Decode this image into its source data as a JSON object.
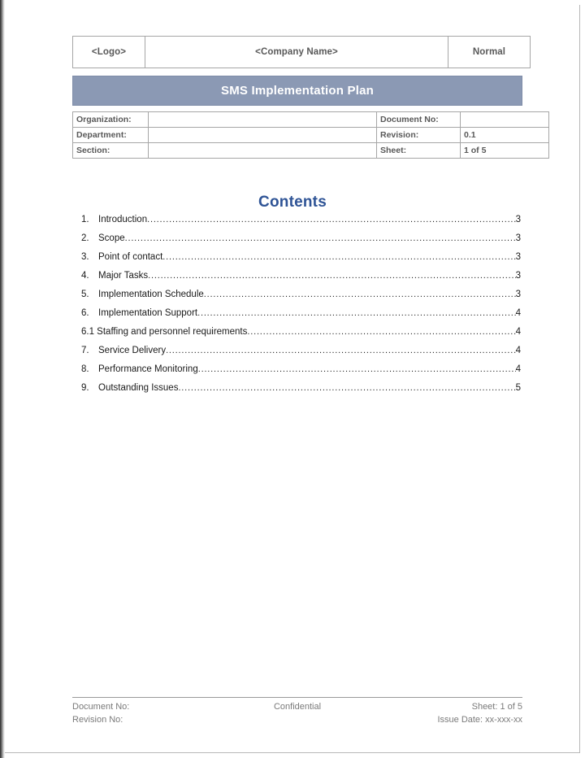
{
  "document": {
    "header_row": {
      "logo": "<Logo>",
      "company_name": "<Company Name>",
      "classification": "Normal"
    },
    "title_band": {
      "title": "SMS Implementation Plan",
      "background_color": "#8b99b4",
      "text_color": "#ffffff"
    },
    "meta_table": {
      "rows": [
        {
          "label": "Organization:",
          "value": "",
          "right_label": "Document No:",
          "right_value": ""
        },
        {
          "label": "Department:",
          "value": "",
          "right_label": "Revision:",
          "right_value": "0.1"
        },
        {
          "label": "Section:",
          "value": "",
          "right_label": "Sheet:",
          "right_value": "1 of 5"
        }
      ]
    },
    "contents": {
      "heading": "Contents",
      "heading_color": "#2f5496",
      "entries": [
        {
          "number": "1.",
          "label": "Introduction",
          "page": "3",
          "flat": false
        },
        {
          "number": "2.",
          "label": "Scope ",
          "page": "3",
          "flat": false
        },
        {
          "number": "3.",
          "label": "Point of contact ",
          "page": "3",
          "flat": false
        },
        {
          "number": "4.",
          "label": "Major Tasks",
          "page": "3",
          "flat": false
        },
        {
          "number": "5.",
          "label": "Implementation Schedule ",
          "page": "3",
          "flat": false
        },
        {
          "number": "6.",
          "label": "Implementation Support ",
          "page": "4",
          "flat": false
        },
        {
          "number": "",
          "label": "6.1 Staffing and personnel requirements",
          "page": "4",
          "flat": true
        },
        {
          "number": "7.",
          "label": "Service Delivery ",
          "page": "4",
          "flat": false
        },
        {
          "number": "8.",
          "label": "Performance Monitoring ",
          "page": "4",
          "flat": false
        },
        {
          "number": "9.",
          "label": "Outstanding Issues",
          "page": "5",
          "flat": false
        }
      ]
    },
    "footer": {
      "document_no": "Document No:",
      "revision_no": "Revision No:",
      "confidential": "Confidential",
      "sheet": "Sheet: 1 of 5",
      "issue_date": "Issue Date: xx-xxx-xx"
    }
  }
}
